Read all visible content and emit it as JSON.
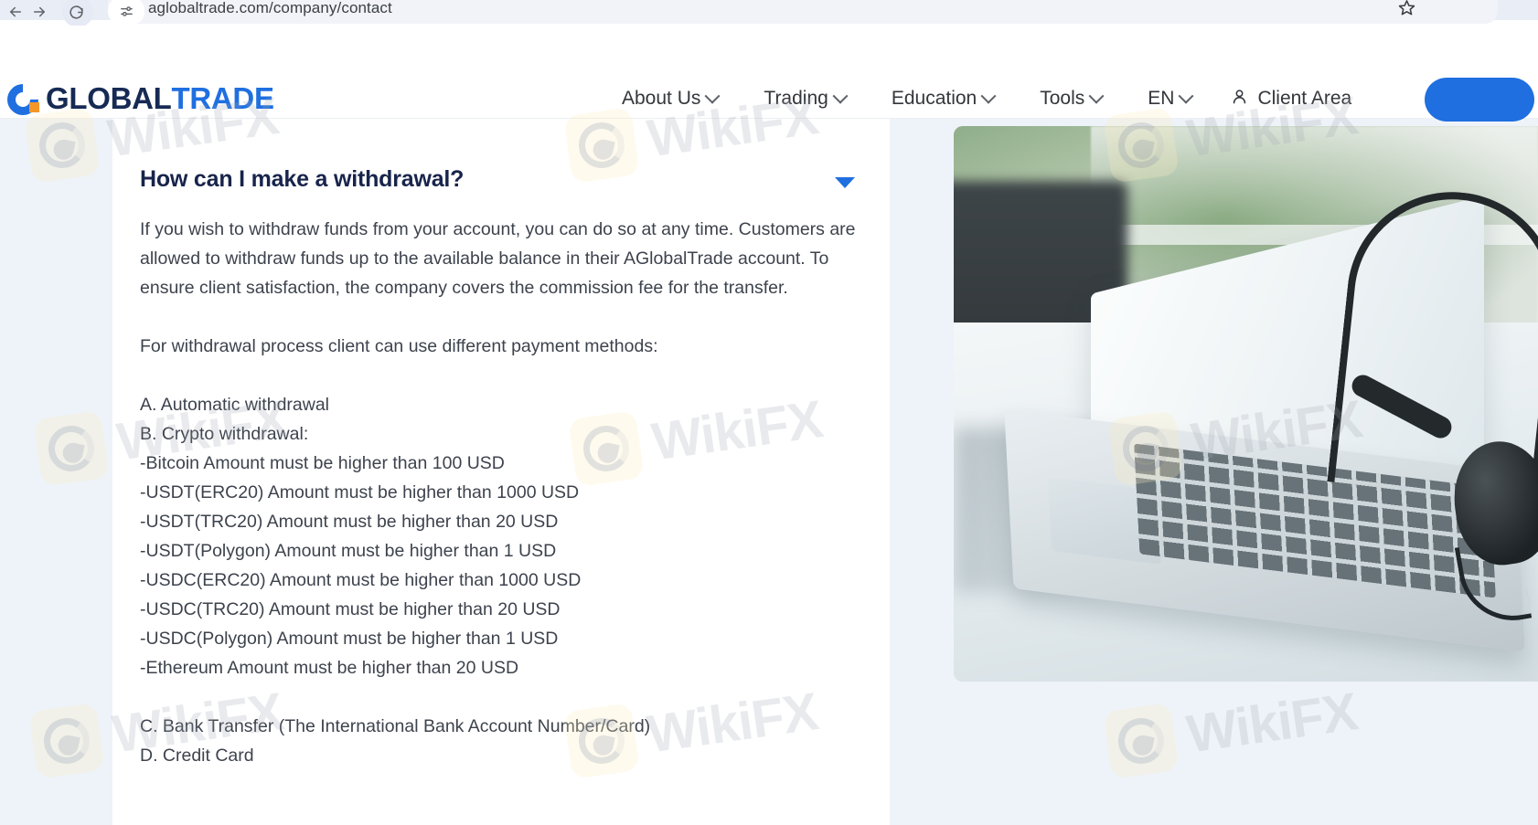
{
  "browser": {
    "url": "aglobaltrade.com/company/contact",
    "back_icon": "back-arrow-icon",
    "forward_icon": "forward-arrow-icon",
    "reload_icon": "reload-icon",
    "site_info_icon": "site-settings-icon",
    "bookmark_icon": "bookmark-star-icon"
  },
  "header": {
    "logo": {
      "mark": "c-logo-icon",
      "text_primary": "GLOBAL",
      "text_secondary": "TRADE",
      "color_primary": "#162a54",
      "color_secondary": "#1f6fe0",
      "accent_dot": "#f59728"
    },
    "nav": [
      {
        "label": "About Us",
        "has_dropdown": true
      },
      {
        "label": "Trading",
        "has_dropdown": true
      },
      {
        "label": "Education",
        "has_dropdown": true
      },
      {
        "label": "Tools",
        "has_dropdown": true
      },
      {
        "label": "EN",
        "has_dropdown": true
      }
    ],
    "client_area": {
      "label": "Client Area",
      "icon": "user-person-icon"
    },
    "cta_color": "#1f6fe0"
  },
  "faq": {
    "question": "How can I make a withdrawal?",
    "toggle_icon": "caret-down-icon",
    "toggle_color": "#1f6fe0",
    "intro": "If you wish to withdraw funds from your account, you can do so at any time. Customers are allowed to withdraw funds up to the available balance in their AGlobalTrade account. To ensure client satisfaction, the company covers the commission fee for the transfer.",
    "methods_lead": "For withdrawal process client can use different payment methods:",
    "methods": [
      "A. Automatic withdrawal",
      "B. Crypto withdrawal:",
      "-Bitcoin Amount must be higher than 100 USD",
      "-USDT(ERC20) Amount must be higher than 1000 USD",
      "-USDT(TRC20) Amount must be higher than 20 USD",
      "-USDT(Polygon) Amount must be higher than 1 USD",
      "-USDC(ERC20) Amount must be higher than 1000 USD",
      "-USDC(TRC20) Amount must be higher than 20 USD",
      "-USDC(Polygon) Amount must be higher than 1 USD",
      "-Ethereum Amount must be higher than 20 USD"
    ],
    "methods_tail": [
      "C. Bank Transfer (The International Bank Account Number/Card)",
      "D. Credit Card"
    ]
  },
  "media": {
    "photo_alt": "laptop-with-headset-photo"
  },
  "watermark": {
    "text": "WikiFX",
    "badge_icon": "wikifx-bird-icon"
  }
}
